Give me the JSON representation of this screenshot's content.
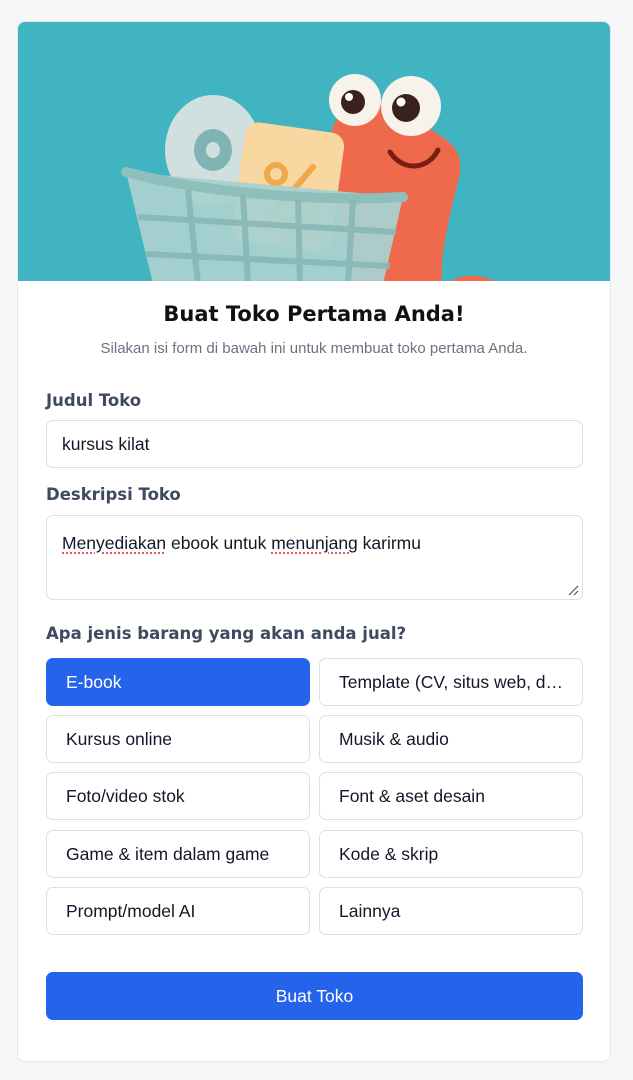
{
  "form": {
    "title": "Buat Toko Pertama Anda!",
    "subtitle": "Silakan isi form di bawah ini untuk membuat toko pertama Anda.",
    "store_title_label": "Judul Toko",
    "store_title_value": "kursus kilat",
    "description_label": "Deskripsi Toko",
    "description_words": [
      "Menyediakan",
      " ebook untuk ",
      "menunjang",
      " karirmu"
    ],
    "product_type_label": "Apa jenis barang yang akan anda jual?",
    "product_types": [
      {
        "label": "E-book",
        "selected": true
      },
      {
        "label": "Template (CV, situs web, desain)",
        "selected": false
      },
      {
        "label": "Kursus online",
        "selected": false
      },
      {
        "label": "Musik & audio",
        "selected": false
      },
      {
        "label": "Foto/video stok",
        "selected": false
      },
      {
        "label": "Font & aset desain",
        "selected": false
      },
      {
        "label": "Game & item dalam game",
        "selected": false
      },
      {
        "label": "Kode & skrip",
        "selected": false
      },
      {
        "label": "Prompt/model AI",
        "selected": false
      },
      {
        "label": "Lainnya",
        "selected": false
      }
    ],
    "submit_label": "Buat Toko"
  },
  "colors": {
    "accent": "#2563eb",
    "hero_background": "#40b5c1"
  },
  "hero": {
    "illustration": "shopping-cart-with-disc-and-percent-tag-and-orange-worm-mascot"
  }
}
